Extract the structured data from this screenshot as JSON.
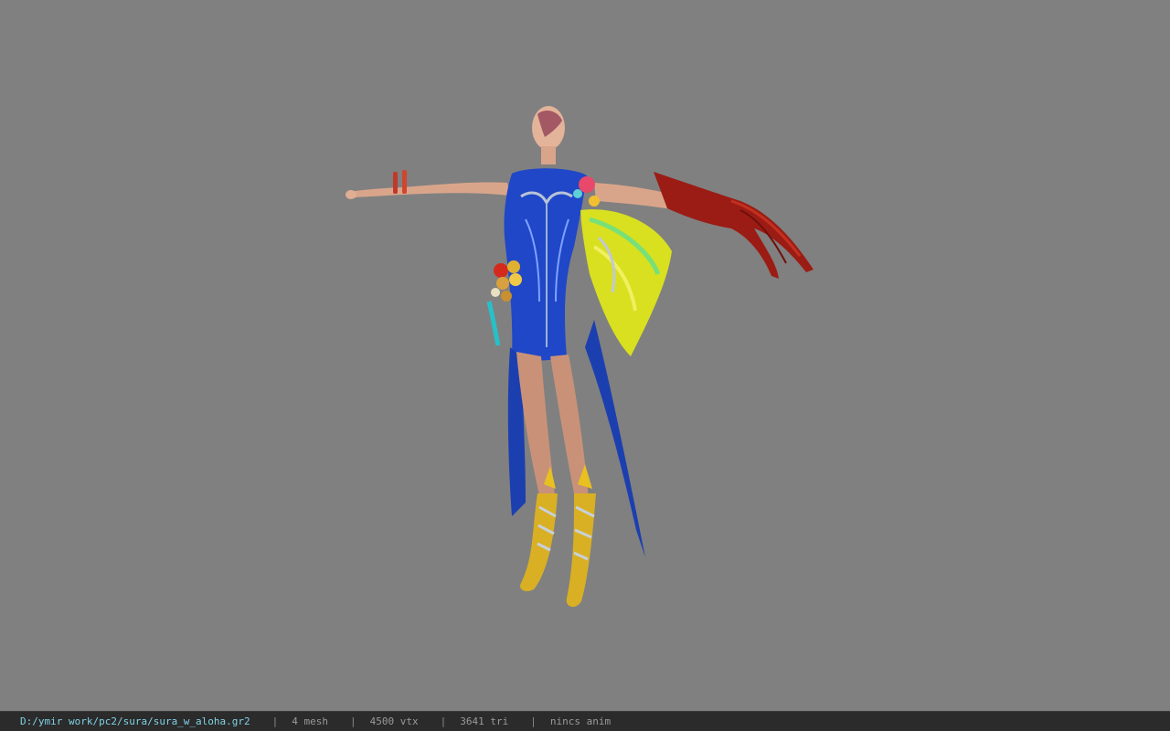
{
  "viewport": {
    "background_color": "#808080",
    "model": {
      "subject": "character-model",
      "pose": "T-pose"
    }
  },
  "statusbar": {
    "file_path": "D:/ymir work/pc2/sura/sura_w_aloha.gr2",
    "separator": "|",
    "mesh_count": "4 mesh",
    "vertex_count": "4500 vtx",
    "triangle_count": "3641 tri",
    "animation": "nincs anim",
    "path_color": "#7fd3e6",
    "text_color": "#9a9a9a"
  }
}
